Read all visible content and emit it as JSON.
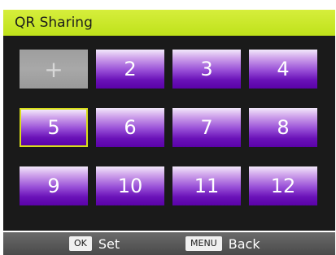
{
  "header": {
    "title": "QR Sharing"
  },
  "grid": {
    "add_symbol": "+",
    "selected_label": "5",
    "tiles": [
      "2",
      "3",
      "4",
      "5",
      "6",
      "7",
      "8",
      "9",
      "10",
      "11",
      "12"
    ]
  },
  "footer": {
    "ok_key": "OK",
    "ok_label": "Set",
    "menu_key": "MENU",
    "menu_label": "Back"
  },
  "colors": {
    "header": "#c8e62a",
    "tile": "#7a2ac8",
    "selection": "#d8de1a",
    "panel": "#1a1a1a"
  }
}
